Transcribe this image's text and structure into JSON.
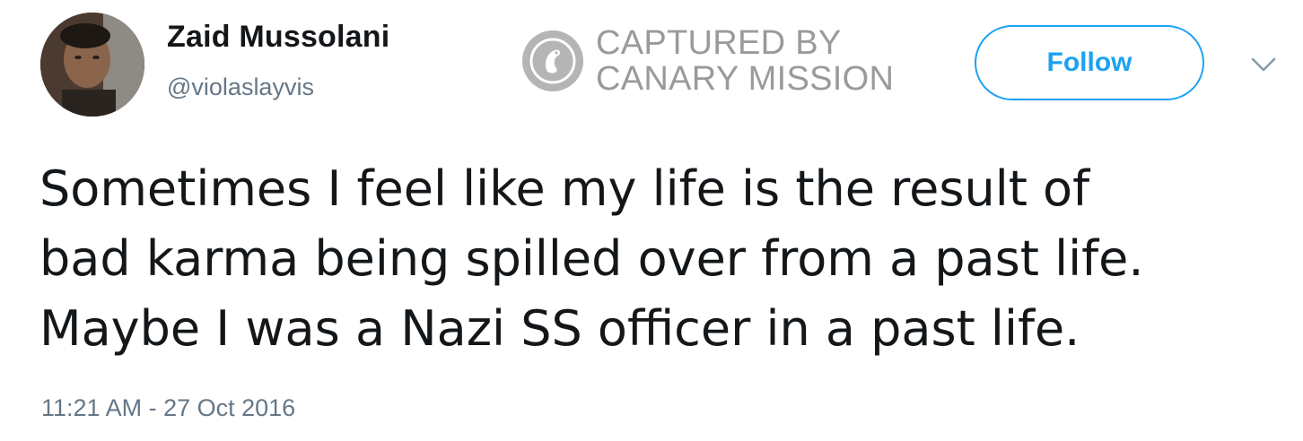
{
  "header": {
    "display_name": "Zaid Mussolani",
    "handle": "@violaslayvis",
    "follow_label": "Follow"
  },
  "watermark": {
    "line1": "CAPTURED BY",
    "line2": "CANARY MISSION",
    "color": "#9a9a9a"
  },
  "tweet": {
    "lines": [
      "Sometimes I feel like my life is the result of",
      "bad karma being spilled over from a past life.",
      "Maybe I was a Nazi SS officer in a past life."
    ],
    "timestamp": "11:21 AM - 27 Oct 2016"
  },
  "icons": {
    "more": "chevron-down-icon",
    "seal": "canary-seal-icon"
  },
  "colors": {
    "accent": "#1da1f2",
    "secondary_text": "#657786",
    "primary_text": "#14171a"
  }
}
